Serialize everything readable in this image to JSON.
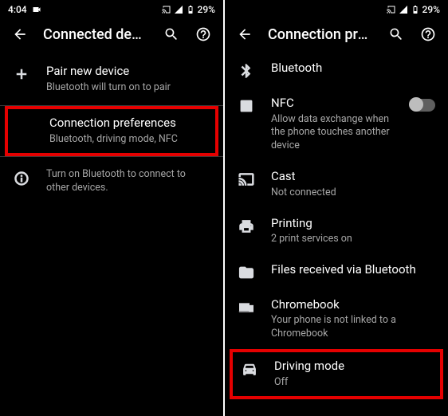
{
  "statusbar": {
    "time": "4:04",
    "battery": "29%"
  },
  "left": {
    "title": "Connected devices",
    "pair": {
      "title": "Pair new device",
      "sub": "Bluetooth will turn on to pair"
    },
    "connpref": {
      "title": "Connection preferences",
      "sub": "Bluetooth, driving mode, NFC"
    },
    "info": "Turn on Bluetooth to connect to other devices."
  },
  "right": {
    "title": "Connection preferen...",
    "bluetooth": {
      "title": "Bluetooth"
    },
    "nfc": {
      "title": "NFC",
      "sub": "Allow data exchange when the phone touches another device"
    },
    "cast": {
      "title": "Cast",
      "sub": "Not connected"
    },
    "printing": {
      "title": "Printing",
      "sub": "2 print services on"
    },
    "files": {
      "title": "Files received via Bluetooth"
    },
    "chromebook": {
      "title": "Chromebook",
      "sub": "Your phone is not linked to a Chromebook"
    },
    "driving": {
      "title": "Driving mode",
      "sub": "Off"
    }
  }
}
